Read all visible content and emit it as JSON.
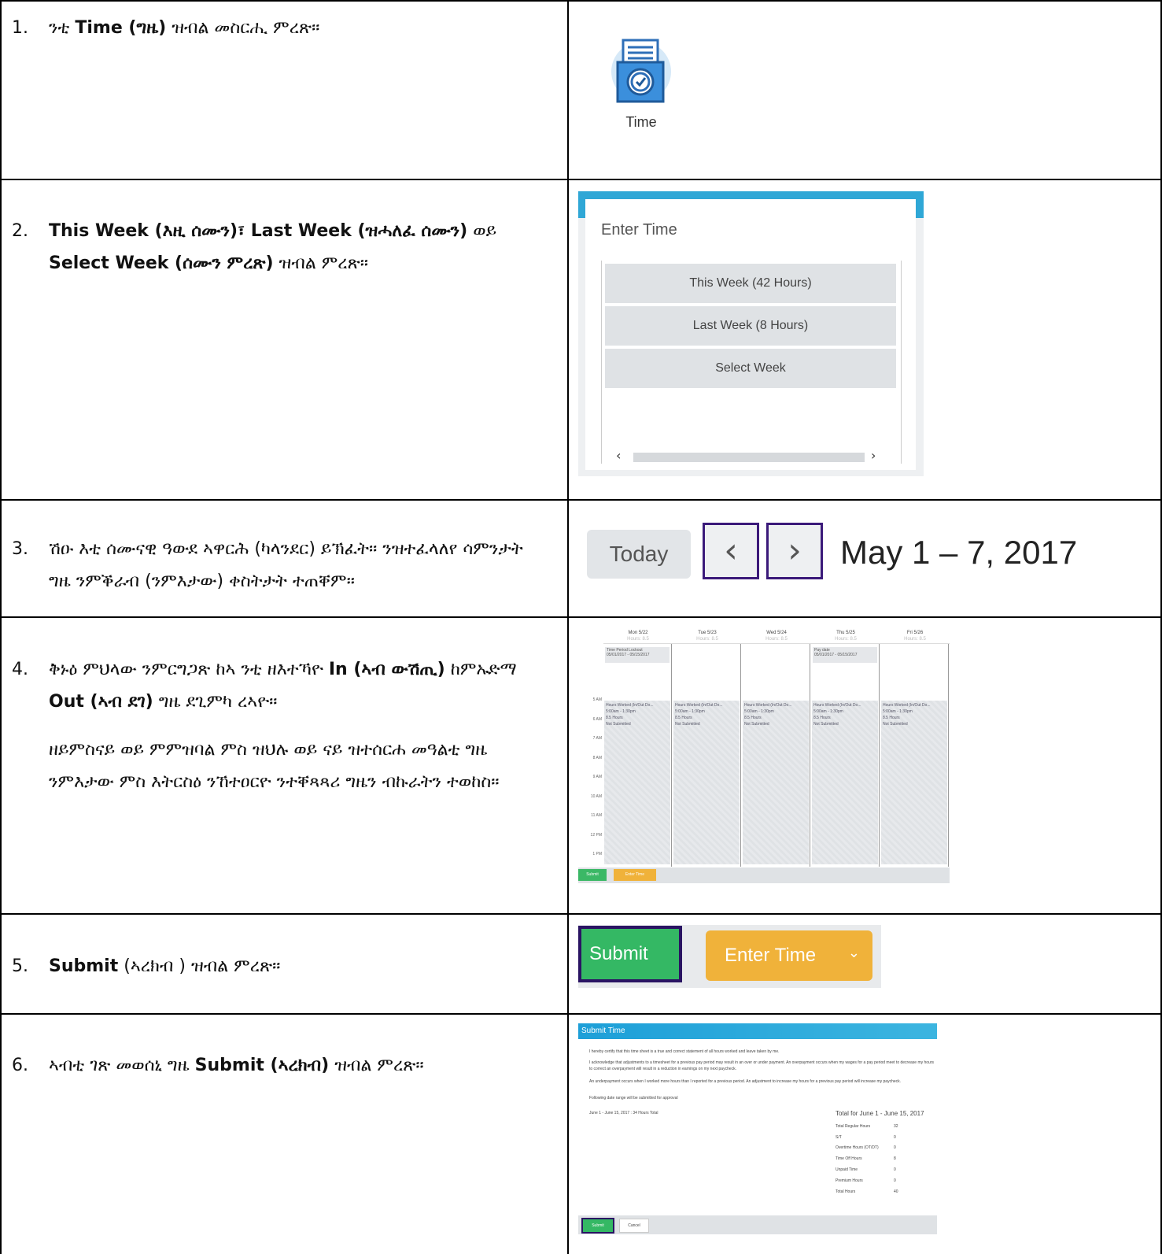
{
  "steps": [
    {
      "num": "1.",
      "a": "ንቲ ",
      "b1": "Time (ግዜ)",
      "c": " ዝብል መስርሒ ምረጽ።"
    },
    {
      "num": "2.",
      "b1": "This Week (እዚ ሰሙን)፣ Last Week (ዝሓለፈ ሰሙን)",
      "c": " ወይ ",
      "b2": "Select Week (ሰሙን ምረጽ)",
      "d": " ዝብል ምረጽ።"
    },
    {
      "num": "3.",
      "a": "ሽዑ እቲ ሰሙናዊ ዓውደ ኣዋርሕ (ካላንደር) ይኽፈት። ንዝተፈላለየ ሳምንታት ግዜ ንምቕራብ (ንምእታው) ቀስትታት ተጠቐም።"
    },
    {
      "num": "4.",
      "a": "ቅኑዕ ምህላው ንምርግጋጽ ከኣ ንቲ ዘእተኻዮ ",
      "b1": "In (ኣብ ውሽጢ)",
      "c": " ከምኡድማ ",
      "b2": "Out (ኣብ ደገ)",
      "d": " ግዜ ደጊምካ ረኣዮ።",
      "p2": "ዘይምስናይ ወይ ምምዝባል ምስ ዝህሉ ወይ ናይ ዝተሰርሐ መዓልቲ ግዜ ንምእታው ምስ እትርስዕ ንኸተዐርዮ ንተቐጻጻሪ ግዜን ብኩራትን ተወከስ።"
    },
    {
      "num": "5.",
      "b1": "Submit",
      "c": " (ኣረክብ ) ዝብል ምረጽ።"
    },
    {
      "num": "6.",
      "a": "ኣብቲ ገጽ መወሰኒ ግዜ ",
      "b1": "Submit (ኣረክብ)",
      "c": " ዝብል ምረጽ።"
    }
  ],
  "time_app": {
    "label": "Time"
  },
  "enter_time": {
    "title": "Enter Time",
    "options": [
      "This Week (42 Hours)",
      "Last Week (8 Hours)",
      "Select Week"
    ],
    "scroll_left": "‹",
    "scroll_right": "›"
  },
  "nav": {
    "today": "Today",
    "prev": "‹",
    "next": "›",
    "date_range": "May 1 – 7, 2017"
  },
  "calendar": {
    "days": [
      {
        "day": "Mon 5/22",
        "hours": "Hours: 8.5"
      },
      {
        "day": "Tue 5/23",
        "hours": "Hours: 8.5"
      },
      {
        "day": "Wed 5/24",
        "hours": "Hours: 8.5"
      },
      {
        "day": "Thu 5/25",
        "hours": "Hours: 8.5"
      },
      {
        "day": "Fri 5/26",
        "hours": "Hours: 8.5"
      }
    ],
    "allday": [
      {
        "title": "Time Period Lockout",
        "sub": "05/01/2017 - 05/15/2017"
      },
      null,
      null,
      {
        "title": "Pay date",
        "sub": "05/01/2017 - 05/15/2017"
      },
      null
    ],
    "entry": {
      "title": "Hours Worked (In/Out Do...",
      "time": "5:00am - 1:30pm",
      "hours": "8.5 Hours",
      "status": "Not Submitted"
    },
    "times": [
      "5 AM",
      "6 AM",
      "7 AM",
      "8 AM",
      "9 AM",
      "10 AM",
      "11 AM",
      "12 PM",
      "1 PM"
    ],
    "submit": "Submit",
    "enter_time": "Enter Time"
  },
  "row5": {
    "submit": "Submit",
    "enter_time": "Enter Time",
    "chevron": "⌄"
  },
  "submit_dialog": {
    "title": "Submit Time",
    "p1": "I hereby certify that this time sheet is a true and correct statement of all hours worked and leave taken by me.",
    "p2": "I acknowledge that adjustments to a timesheet for a previous pay period may result in an over or under payment. An overpayment occurs when my wages for a pay period meet to decrease my hours to correct an overpayment will result in a reduction in earnings on my next paycheck.",
    "p3": "An underpayment occurs when I worked more hours than I reported for a previous period. An adjustment to increase my hours for a previous pay period will increase my paycheck.",
    "p4": "Following date range will be submitted for approval",
    "range": "June 1 - June 15, 2017 : 34 Hours Total",
    "total_title": "Total for June 1 - June 15, 2017",
    "totals": [
      {
        "label": "Total Regular Hours",
        "value": "32"
      },
      {
        "label": "S/T",
        "value": "0"
      },
      {
        "label": "Overtime Hours (OT/DT)",
        "value": "0"
      },
      {
        "label": "Time Off Hours",
        "value": "8"
      },
      {
        "label": "Unpaid Time",
        "value": "0"
      },
      {
        "label": "Premium Hours",
        "value": "0"
      },
      {
        "label": "Total Hours",
        "value": "40"
      }
    ],
    "submit": "Submit",
    "cancel": "Cancel"
  }
}
